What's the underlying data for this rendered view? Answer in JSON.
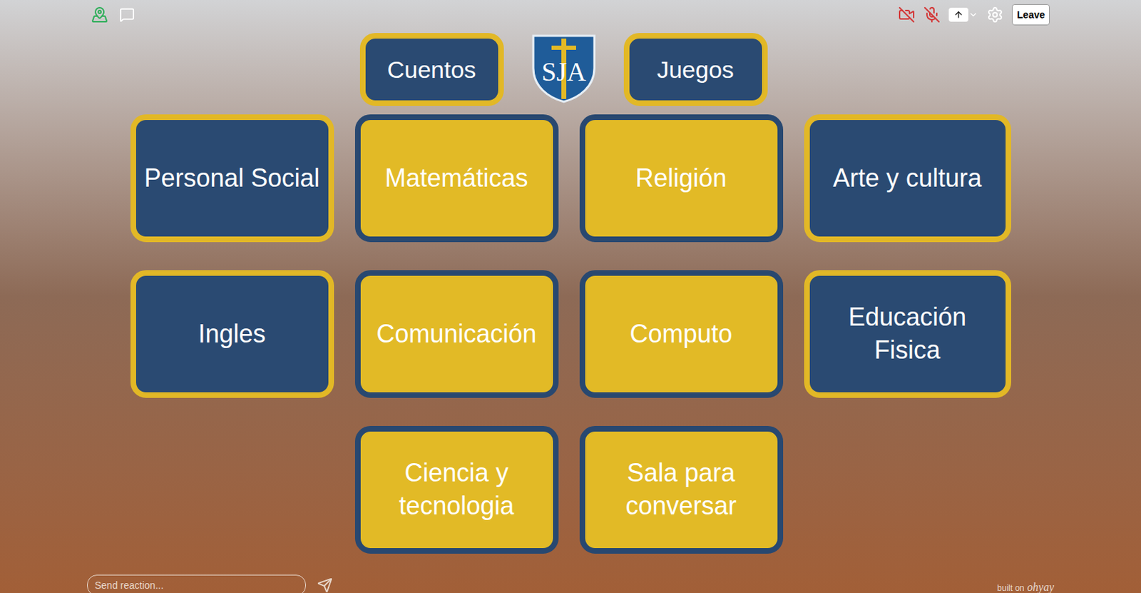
{
  "toolbar": {
    "camera_on": false,
    "mic_on": false,
    "leave": "Leave"
  },
  "logo": {
    "text": "SJA"
  },
  "top_links": [
    {
      "label": "Cuentos"
    },
    {
      "label": "Juegos"
    }
  ],
  "tiles": [
    {
      "label": "Personal Social",
      "kind": "blue"
    },
    {
      "label": "Matemáticas",
      "kind": "yellow"
    },
    {
      "label": "Religión",
      "kind": "yellow"
    },
    {
      "label": "Arte y cultura",
      "kind": "blue"
    },
    {
      "label": "Ingles",
      "kind": "blue"
    },
    {
      "label": "Comunicación",
      "kind": "yellow"
    },
    {
      "label": "Computo",
      "kind": "yellow"
    },
    {
      "label": "Educación Fisica",
      "kind": "blue"
    },
    {
      "label": "Ciencia y tecnologia",
      "kind": "yellow"
    },
    {
      "label": "Sala para conversar",
      "kind": "yellow"
    }
  ],
  "reaction": {
    "placeholder": "Send reaction..."
  },
  "footer": {
    "built_on": "built on",
    "brand": "ohyay"
  }
}
